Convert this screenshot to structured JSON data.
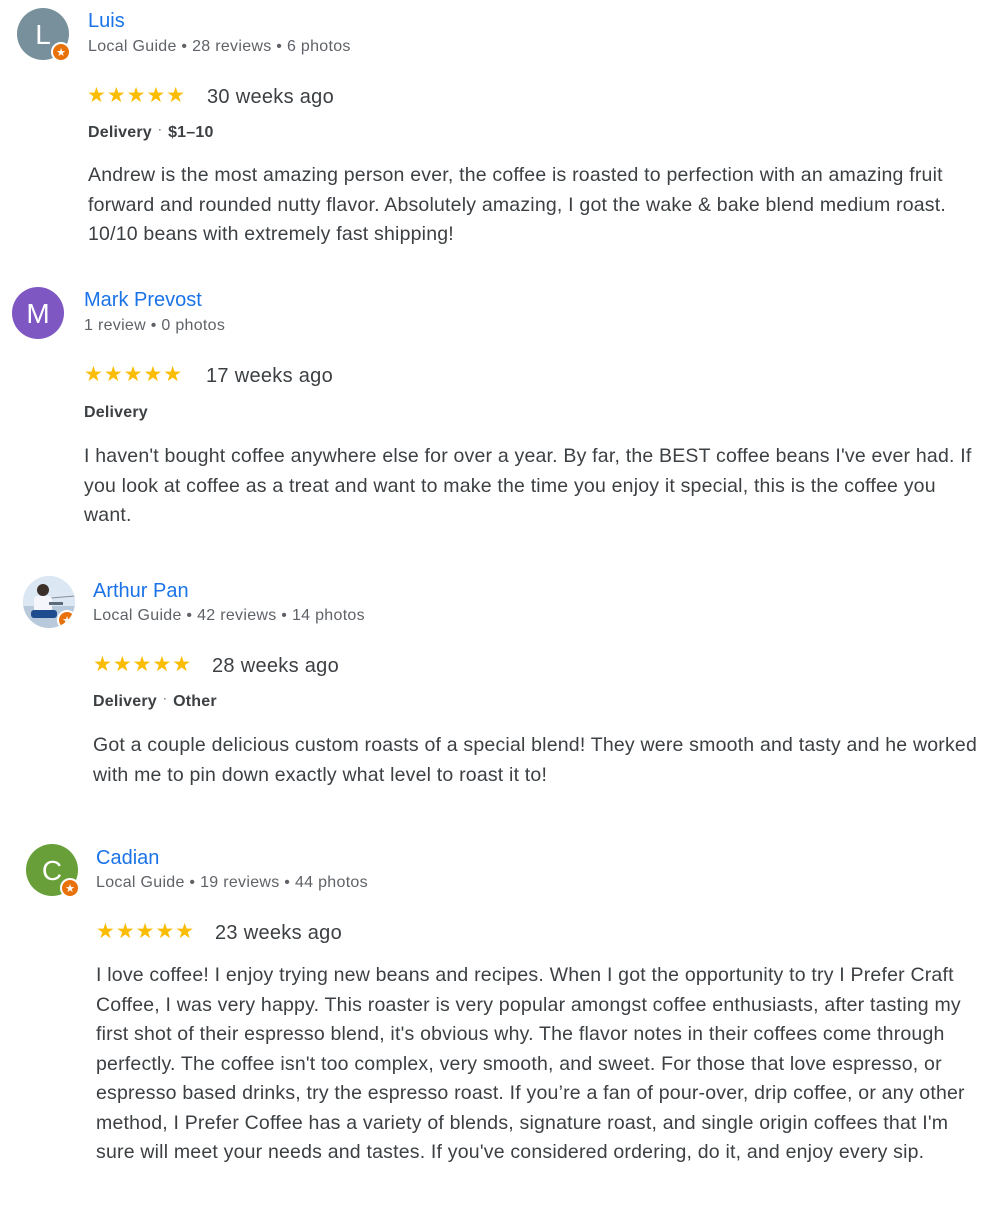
{
  "reviews": [
    {
      "name": "Luis",
      "initial": "L",
      "meta": "Local Guide • 28 reviews • 6 photos",
      "stars": "★★★★★",
      "rating": 5,
      "time": "30 weeks ago",
      "tag1": "Delivery",
      "tag_sep": "·",
      "tag2": "$1–10",
      "text": "Andrew is the most amazing person ever, the coffee is roasted to perfection with an amazing fruit forward and rounded nutty flavor. Absolutely amazing, I got the wake & bake blend medium roast. 10/10 beans with extremely fast shipping!",
      "avatar_color": "#78909c"
    },
    {
      "name": "Mark Prevost",
      "initial": "M",
      "meta": "1 review • 0 photos",
      "stars": "★★★★★",
      "rating": 5,
      "time": "17 weeks ago",
      "tag1": "Delivery",
      "text": "I haven't bought coffee anywhere else for over a year. By far, the BEST coffee beans I've ever had. If you look at coffee as a treat and want to make the time you enjoy it special, this is the coffee you want.",
      "avatar_color": "#7e57c2"
    },
    {
      "name": "Arthur Pan",
      "meta": "Local Guide • 42 reviews • 14 photos",
      "stars": "★★★★★",
      "rating": 5,
      "time": "28 weeks ago",
      "tag1": "Delivery",
      "tag_sep": "·",
      "tag2": "Other",
      "text": "Got a couple delicious custom roasts of a special blend! They were smooth and tasty and he worked with me to pin down exactly what level to roast it to!"
    },
    {
      "name": "Cadian",
      "initial": "C",
      "meta": "Local Guide • 19 reviews • 44 photos",
      "stars": "★★★★★",
      "rating": 5,
      "time": "23 weeks ago",
      "text": "I love coffee! I enjoy trying new beans and recipes. When I got the opportunity to try I Prefer Craft Coffee, I was very happy. This roaster is very popular amongst coffee enthusiasts, after tasting my first shot of their espresso blend, it's obvious why. The flavor notes in their coffees come through perfectly. The coffee isn't too complex, very smooth, and sweet. For those that love espresso, or espresso based drinks, try the espresso roast. If you’re a fan of pour-over, drip coffee, or any other method, I Prefer Coffee has a variety of blends, signature roast, and single origin coffees that I'm sure will meet your needs and tastes. If you've considered ordering, do it, and enjoy every sip.",
      "avatar_color": "#689f38"
    }
  ],
  "icons": {
    "star": "star-icon",
    "local_guide_badge": "local-guide-star-badge-icon",
    "badge_glyph": "★"
  },
  "colors": {
    "name_link": "#1a73e8",
    "star": "#fbbc04",
    "local_guide_badge": "#e8710a"
  }
}
